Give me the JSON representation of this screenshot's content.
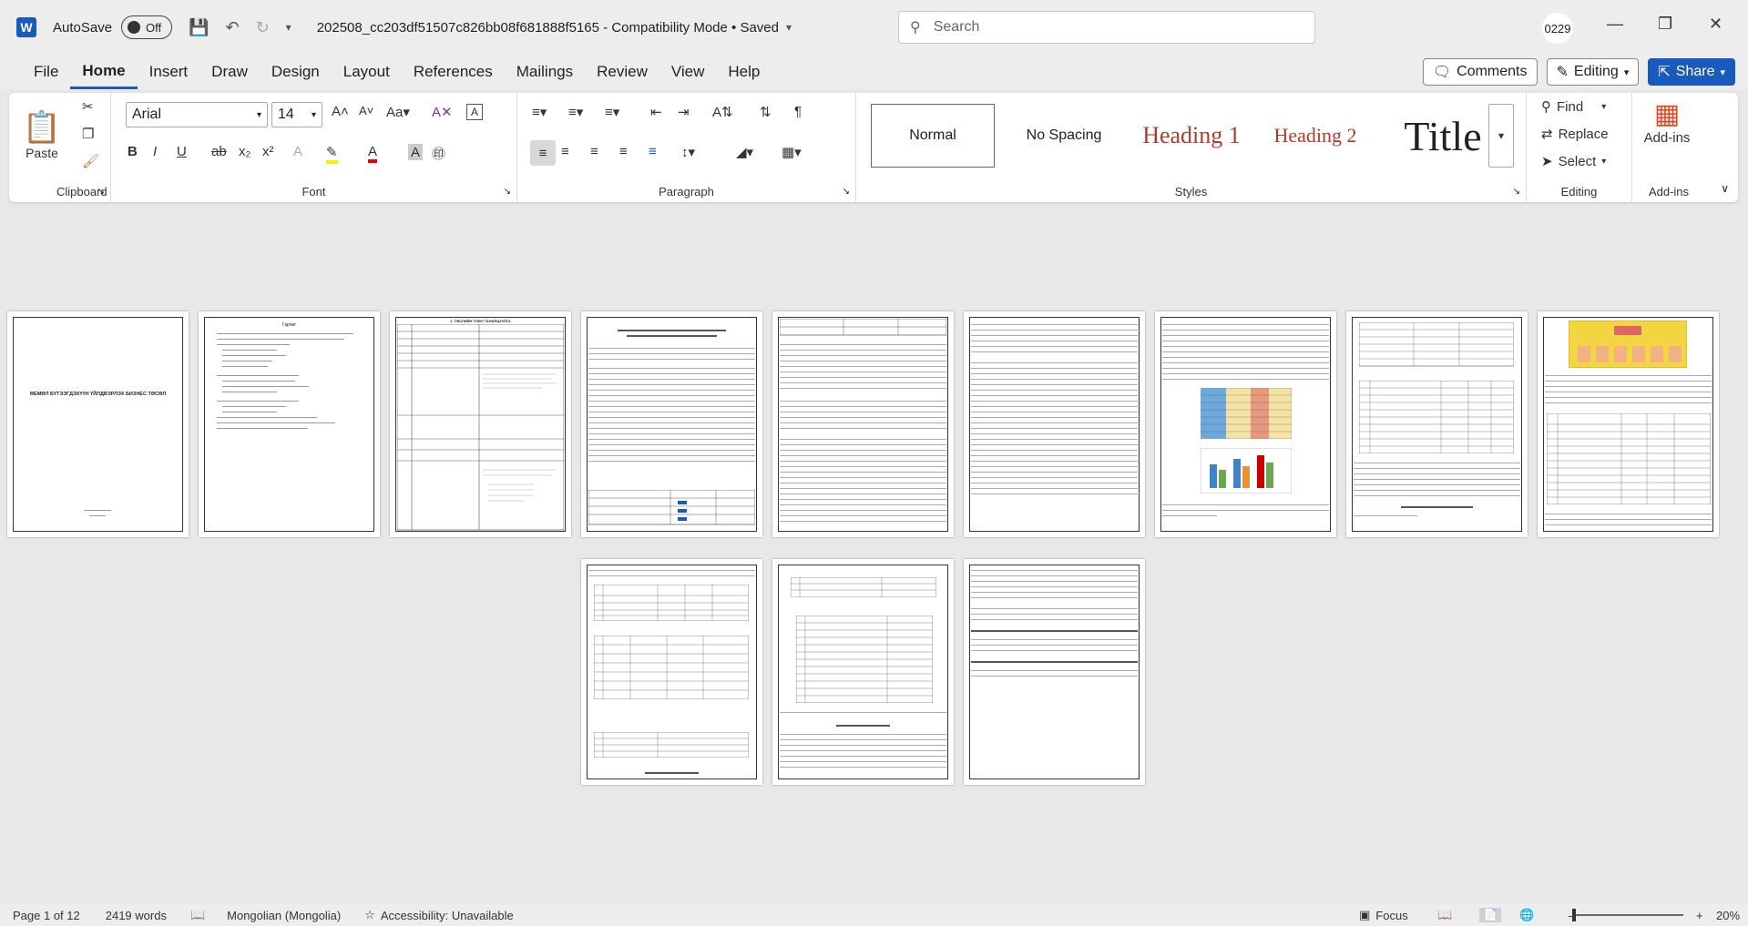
{
  "titlebar": {
    "autosave_label": "AutoSave",
    "toggle_state": "Off",
    "doc_title": "202508_cc203df51507c826bb08f681888f5165  -  Compatibility Mode  •  Saved",
    "search_placeholder": "Search",
    "user_initials": "0229"
  },
  "menu": {
    "items": [
      "File",
      "Home",
      "Insert",
      "Draw",
      "Design",
      "Layout",
      "References",
      "Mailings",
      "Review",
      "View",
      "Help"
    ],
    "active": "Home",
    "comments_label": "Comments",
    "editing_label": "Editing",
    "share_label": "Share"
  },
  "ribbon": {
    "clipboard": {
      "label": "Clipboard",
      "paste": "Paste"
    },
    "font": {
      "label": "Font",
      "family": "Arial",
      "size": "14"
    },
    "paragraph": {
      "label": "Paragraph"
    },
    "styles": {
      "label": "Styles",
      "items": [
        "Normal",
        "No Spacing",
        "Heading 1",
        "Heading 2",
        "Title"
      ]
    },
    "editing": {
      "label": "Editing",
      "find": "Find",
      "replace": "Replace",
      "select": "Select"
    },
    "addins": {
      "label": "Add-ins",
      "button": "Add-ins"
    }
  },
  "document": {
    "cover_title": "ӨЕМӨЛ БҮТЭЭГДЭХҮҮН ҮЙЛДВЭРЛЭХ БИЗНЕС ТӨСӨЛ",
    "page2_heading": "Гарчиг",
    "page3_heading": "1. ТӨСЛИЙН ТОВЧ ТАНИЛЦУУЛГА"
  },
  "statusbar": {
    "page": "Page 1 of 12",
    "words": "2419 words",
    "language": "Mongolian (Mongolia)",
    "accessibility": "Accessibility: Unavailable",
    "focus": "Focus",
    "zoom": "20%"
  }
}
